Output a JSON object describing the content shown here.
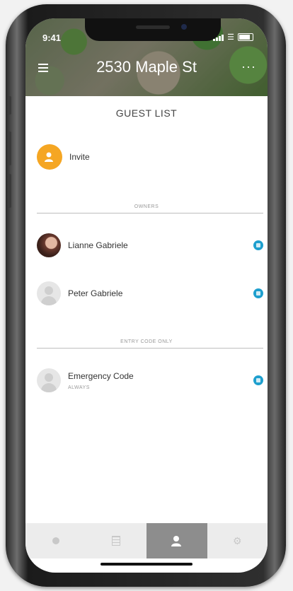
{
  "status_bar": {
    "time": "9:41"
  },
  "header": {
    "title": "2530 Maple St"
  },
  "section": {
    "title": "GUEST LIST"
  },
  "invite": {
    "label": "Invite"
  },
  "owners": {
    "heading": "OWNERS",
    "people": [
      {
        "name": "Lianne Gabriele"
      },
      {
        "name": "Peter Gabriele"
      }
    ]
  },
  "entry_code": {
    "heading": "ENTRY CODE ONLY",
    "people": [
      {
        "name": "Emergency Code",
        "schedule": "ALWAYS"
      }
    ]
  },
  "tabs": [
    {
      "icon": "circle-dot-icon"
    },
    {
      "icon": "grid-icon"
    },
    {
      "icon": "person-icon",
      "active": true
    },
    {
      "icon": "gear-icon"
    }
  ],
  "colors": {
    "accent": "#f5a623",
    "status": "#1e9fce",
    "active_tab": "#8d8d8d"
  }
}
